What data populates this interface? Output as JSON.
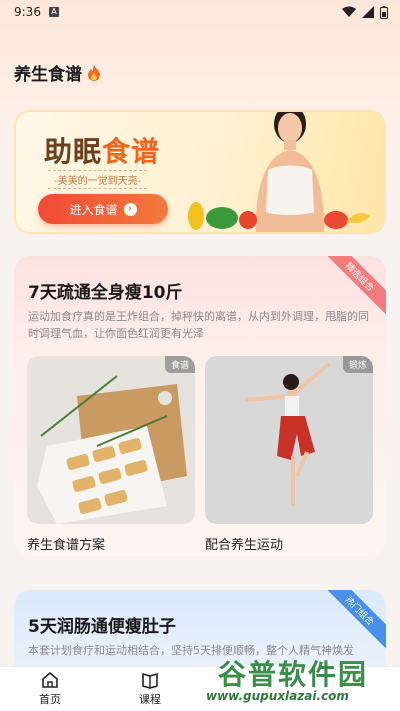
{
  "status": {
    "time": "9:36",
    "notif": "A"
  },
  "page": {
    "title": "养生食谱"
  },
  "banner": {
    "title_a": "助眠",
    "title_b": "食谱",
    "subtitle": "-美美的一觉到天亮-",
    "button": "进入食谱"
  },
  "card1": {
    "badge": "精选组合",
    "title": "7天疏通全身瘦10斤",
    "desc": "运动加食疗真的是王炸组合，掉秤快的离谱，从内到外调理，甩脂的同时调理气血，让你面色红润更有光泽",
    "tile_left_tag": "食谱",
    "tile_right_tag": "锻炼",
    "tile_left_label": "养生食谱方案",
    "tile_right_label": "配合养生运动"
  },
  "card2": {
    "badge": "热门组合",
    "title": "5天润肠通便瘦肚子",
    "desc": "本套计划食疗和运动相结合，坚持5天排便顺畅，整个人精气神焕发"
  },
  "tabbar": {
    "home": "首页",
    "course": "课程"
  },
  "watermark": {
    "title": "谷普软件园",
    "url": "www.gupuxlazai.com"
  }
}
